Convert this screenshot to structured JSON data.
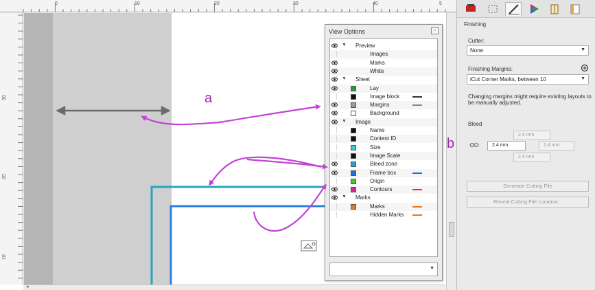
{
  "ruler": {
    "top_numbers": [
      "0",
      "10",
      "20",
      "30",
      "40",
      "5"
    ],
    "left_numbers": [
      "30",
      "20",
      "10"
    ]
  },
  "callouts": {
    "a": "a",
    "b": "b"
  },
  "view_options": {
    "title": "View Options",
    "close_icon": "close-icon",
    "rows": [
      {
        "label": "Preview",
        "level": 0,
        "eye": true,
        "expander": true
      },
      {
        "label": "Images",
        "level": 1,
        "eye": false
      },
      {
        "label": "Marks",
        "level": 1,
        "eye": true
      },
      {
        "label": "White",
        "level": 1,
        "eye": true
      },
      {
        "label": "Sheet",
        "level": 0,
        "eye": true,
        "expander": true
      },
      {
        "label": "Lay",
        "level": 1,
        "eye": true,
        "swatch": "#2e9a36"
      },
      {
        "label": "Image block",
        "level": 1,
        "eye": false,
        "swatch": "#111111",
        "line": "#333333"
      },
      {
        "label": "Margins",
        "level": 1,
        "eye": true,
        "swatch": "#9a9a9a",
        "line": "#888888"
      },
      {
        "label": "Background",
        "level": 1,
        "eye": true,
        "swatch": "#ffffff"
      },
      {
        "label": "Image",
        "level": 0,
        "eye": true,
        "expander": true
      },
      {
        "label": "Name",
        "level": 1,
        "eye": false,
        "swatch": "#111111"
      },
      {
        "label": "Content ID",
        "level": 1,
        "eye": false,
        "swatch": "#111111"
      },
      {
        "label": "Size",
        "level": 1,
        "eye": false,
        "swatch": "#38c8c8"
      },
      {
        "label": "Image Scale",
        "level": 1,
        "eye": false,
        "swatch": "#111111"
      },
      {
        "label": "Bleed zone",
        "level": 1,
        "eye": true,
        "swatch": "#2aa0c8"
      },
      {
        "label": "Frame box",
        "level": 1,
        "eye": true,
        "swatch": "#2a6ad8",
        "line": "#2a6ad8"
      },
      {
        "label": "Origin",
        "level": 1,
        "eye": false,
        "swatch": "#3ac83a"
      },
      {
        "label": "Contours",
        "level": 1,
        "eye": true,
        "swatch": "#d8288a",
        "line": "#d8288a"
      },
      {
        "label": "Marks",
        "level": 0,
        "eye": true,
        "expander": true
      },
      {
        "label": "Marks",
        "level": 1,
        "eye": false,
        "swatch": "#e8761e",
        "line": "#e8761e"
      },
      {
        "label": "Hidden Marks",
        "level": 1,
        "eye": false,
        "line": "#e8761e"
      }
    ],
    "dropdown_value": ""
  },
  "finishing": {
    "tab_icons": [
      "printer-icon",
      "marks-icon",
      "finishing-icon",
      "color-icon",
      "book-icon",
      "layout-icon"
    ],
    "section_title": "Finishing",
    "cutter_label": "Cutter:",
    "cutter_value": "None",
    "margins_label": "Finishing Margins:",
    "margins_value": "iCut Corner Marks, between 10",
    "margins_note": "Changing margins might require existing layouts to be manually adjusted.",
    "bleed_label": "Bleed",
    "bleed_top": "2.4 mm",
    "bleed_left": "2.4 mm",
    "bleed_right": "2.4 mm",
    "bleed_bottom": "2.4 mm",
    "generate_button": "Generate Cutting File",
    "reveal_button": "Reveal Cutting File Location..."
  },
  "colors": {
    "callout": "#c242d6",
    "frame_cyan": "#25a6bf",
    "frame_blue": "#2a7fe6"
  }
}
